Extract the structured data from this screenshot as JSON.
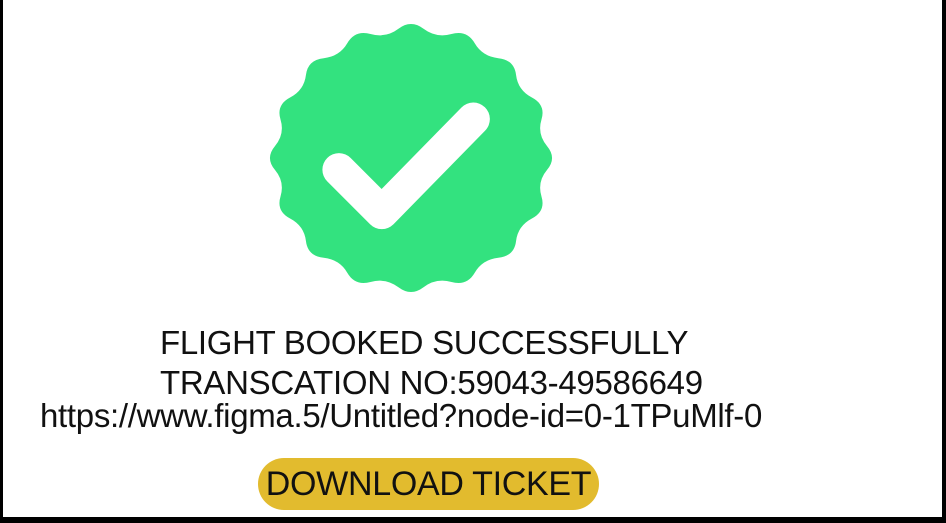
{
  "confirmation": {
    "badge_icon": "verified-check-badge-icon",
    "badge_color": "#33e27f",
    "check_color": "#ffffff",
    "title": "FLIGHT BOOKED SUCCESSFULLY",
    "transaction": "TRANSCATION NO:59043-49586649",
    "url": "https://www.figma.5/Untitled?node-id=0-1TPuMlf-0"
  },
  "actions": {
    "download_label": "DOWNLOAD TICKET",
    "download_color": "#e2bb2e"
  }
}
